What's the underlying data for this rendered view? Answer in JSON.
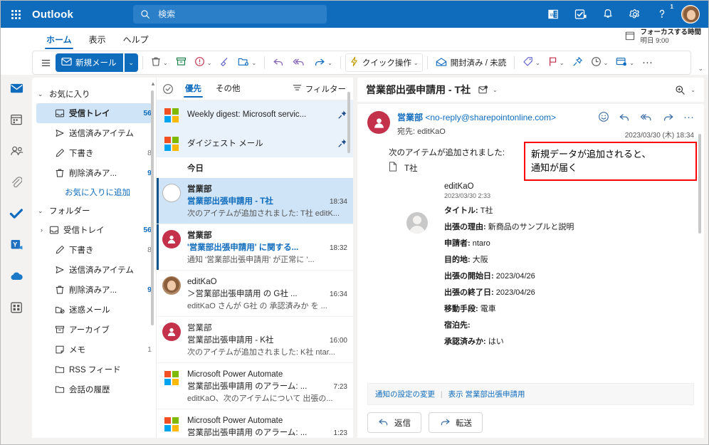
{
  "suite": {
    "brand": "Outlook",
    "waffle_icon": "app-launcher-icon",
    "search": {
      "placeholder": "検索",
      "value": "",
      "icon": "search-icon"
    },
    "icons": [
      {
        "name": "office-apps-icon"
      },
      {
        "name": "teams-meeting-icon"
      },
      {
        "name": "notifications-bell-icon"
      },
      {
        "name": "settings-gear-icon"
      },
      {
        "name": "help-feedback-icon",
        "badge": "1"
      }
    ],
    "avatar_name": "user-avatar"
  },
  "ribbon": {
    "tabs": [
      {
        "label": "ホーム",
        "active": true
      },
      {
        "label": "表示",
        "active": false
      },
      {
        "label": "ヘルプ",
        "active": false
      }
    ],
    "focus_time": {
      "icon": "calendar-icon",
      "title": "フォーカスする時間",
      "subtitle": "明日 9:00"
    }
  },
  "toolbar": {
    "hamburger": "menu-icon",
    "new_mail": "新規メール",
    "new_mail_icon": "envelope-icon",
    "delete_icon": "trash-icon",
    "archive_icon": "archive-icon",
    "report_icon": "report-junk-icon",
    "sweep_icon": "sweep-broom-icon",
    "moveto_icon": "move-to-folder-icon",
    "reply_icon": "reply-icon",
    "replyall_icon": "reply-all-icon",
    "forward_icon": "forward-icon",
    "quick_steps": "クイック操作",
    "quick_steps_icon": "lightning-icon",
    "read_unread": "開封済み / 未読",
    "read_unread_icon": "open-envelope-icon",
    "tag_icon": "tag-icon",
    "flag_icon": "flag-icon",
    "pin_icon": "pin-icon",
    "snooze_icon": "clock-icon",
    "rules_icon": "rules-icon",
    "more_icon": "more-ellipsis-icon"
  },
  "rail": {
    "items": [
      {
        "name": "rail-mail",
        "icon": "mail-icon",
        "active": true
      },
      {
        "name": "rail-calendar",
        "icon": "calendar-icon",
        "active": false
      },
      {
        "name": "rail-people",
        "icon": "people-icon",
        "active": false
      },
      {
        "name": "rail-files",
        "icon": "paperclip-icon",
        "active": false
      },
      {
        "name": "rail-todo",
        "icon": "checkmark-icon",
        "active": false
      },
      {
        "name": "rail-yammer",
        "icon": "yammer-icon",
        "active": false
      },
      {
        "name": "rail-onedrive",
        "icon": "cloud-icon",
        "active": false
      },
      {
        "name": "rail-apps",
        "icon": "apps-grid-icon",
        "active": false
      }
    ]
  },
  "folders": {
    "favorites_label": "お気に入り",
    "favorites": [
      {
        "label": "受信トレイ",
        "count": "56",
        "icon": "inbox-icon",
        "selected": true,
        "dim": false
      },
      {
        "label": "送信済みアイテム",
        "count": "",
        "icon": "sent-icon",
        "selected": false,
        "dim": false
      },
      {
        "label": "下書き",
        "count": "8",
        "icon": "drafts-icon",
        "selected": false,
        "dim": true
      },
      {
        "label": "削除済みア...",
        "count": "9",
        "icon": "trash-icon",
        "selected": false,
        "dim": false
      }
    ],
    "add_favorite": "お気に入りに追加",
    "folders_label": "フォルダー",
    "list": [
      {
        "label": "受信トレイ",
        "count": "56",
        "icon": "inbox-icon",
        "expandable": true,
        "dim": false
      },
      {
        "label": "下書き",
        "count": "8",
        "icon": "drafts-icon",
        "expandable": false,
        "dim": true
      },
      {
        "label": "送信済みアイテム",
        "count": "",
        "icon": "sent-icon",
        "expandable": false,
        "dim": false
      },
      {
        "label": "削除済みア...",
        "count": "9",
        "icon": "trash-icon",
        "expandable": false,
        "dim": false
      },
      {
        "label": "迷惑メール",
        "count": "",
        "icon": "junk-icon",
        "expandable": false,
        "dim": false
      },
      {
        "label": "アーカイブ",
        "count": "",
        "icon": "archive-icon",
        "expandable": false,
        "dim": false
      },
      {
        "label": "メモ",
        "count": "1",
        "icon": "note-icon",
        "expandable": false,
        "dim": true
      },
      {
        "label": "RSS フィード",
        "count": "",
        "icon": "folder-icon",
        "expandable": false,
        "dim": false
      },
      {
        "label": "会話の履歴",
        "count": "",
        "icon": "folder-icon",
        "expandable": false,
        "dim": false
      }
    ]
  },
  "messagelist": {
    "select_all_icon": "select-all-circle-icon",
    "pivots": [
      {
        "label": "優先",
        "active": true
      },
      {
        "label": "その他",
        "active": false
      }
    ],
    "filter_label": "フィルター",
    "filter_icon": "filter-icon",
    "pinned": [
      {
        "title": "Weekly digest: Microsoft servic...",
        "avatar": "microsoft-logo-icon",
        "pin": "pin-icon"
      },
      {
        "title": "ダイジェスト メール",
        "avatar": "microsoft-logo-icon",
        "pin": "pin-icon"
      }
    ],
    "day_separator": "今日",
    "rows": [
      {
        "sender": "営業部",
        "subject": "営業部出張申請用 - T社",
        "time": "18:34",
        "preview": "次のアイテムが追加されました: T社 editK...",
        "avatar": "unread-circle-icon",
        "selected": true,
        "unread": true
      },
      {
        "sender": "営業部",
        "subject": "'営業部出張申請用' に関する...",
        "time": "18:32",
        "preview": "通知 '営業部出張申請用' が正常に '...",
        "avatar": "person-avatar-icon",
        "selected": false,
        "unread": true
      },
      {
        "sender": "editKaO",
        "subject": "＞営業部出張申請用 の G社 ...",
        "time": "16:34",
        "preview": "editKaO さんが G社 の 承認済みか を ...",
        "avatar": "user-photo-avatar",
        "selected": false,
        "unread": false
      },
      {
        "sender": "営業部",
        "subject": "営業部出張申請用 - K社",
        "time": "16:00",
        "preview": "次のアイテムが追加されました: K社 ntar...",
        "avatar": "person-avatar-icon",
        "selected": false,
        "unread": false
      },
      {
        "sender": "Microsoft Power Automate",
        "subject": "営業部出張申請用 のアラーム: ...",
        "time": "7:23",
        "preview": "editKaO、次のアイテムについて 出張の...",
        "avatar": "microsoft-logo-icon",
        "selected": false,
        "unread": false
      },
      {
        "sender": "Microsoft Power Automate",
        "subject": "営業部出張申請用 のアラーム: ...",
        "time": "1:23",
        "preview": "",
        "avatar": "microsoft-logo-icon",
        "selected": false,
        "unread": false
      }
    ]
  },
  "reading": {
    "title": "営業部出張申請用 - T社",
    "title_icon": "categorize-envelope-icon",
    "zoom_icon": "zoom-search-icon",
    "from_name": "営業部",
    "from_address": "<no-reply@sharepointonline.com>",
    "to_label": "宛先: editKaO",
    "date": "2023/03/30 (木) 18:34",
    "actions": [
      {
        "name": "react-emoji-icon"
      },
      {
        "name": "reply-icon"
      },
      {
        "name": "reply-all-icon"
      },
      {
        "name": "forward-icon"
      },
      {
        "name": "more-ellipsis-icon"
      }
    ],
    "intro": "次のアイテムが追加されました:",
    "item_icon": "document-icon",
    "item_name": "T社",
    "detail_user": "editKaO",
    "detail_date": "2023/03/30 2:33",
    "fields": [
      {
        "label": "タイトル:",
        "value": " T社"
      },
      {
        "label": "出張の理由:",
        "value": " 新商品のサンプルと説明"
      },
      {
        "label": "申請者:",
        "value": " ntaro"
      },
      {
        "label": "目的地:",
        "value": " 大阪"
      },
      {
        "label": "出張の開始日:",
        "value": " 2023/04/26"
      },
      {
        "label": "出張の終了日:",
        "value": " 2023/04/26"
      },
      {
        "label": "移動手段:",
        "value": " 電車"
      },
      {
        "label": "宿泊先:",
        "value": ""
      },
      {
        "label": "承認済みか:",
        "value": " はい"
      }
    ],
    "annotation": {
      "line1": "新規データが追加されると、",
      "line2": "通知が届く",
      "border_color": "#ff0000"
    },
    "footer_links": {
      "settings": "通知の設定の変更",
      "show_label": "表示",
      "show_target": "営業部出張申請用"
    },
    "reply_button": "返信",
    "reply_icon": "reply-icon",
    "forward_button": "転送",
    "forward_icon": "forward-icon"
  },
  "colors": {
    "brand_blue": "#0f6cbd",
    "selection_blue": "#cfe4f7",
    "pinned_blue": "#e9f2fb",
    "avatar_red": "#c4314b",
    "annotation_red": "#ff0000"
  }
}
